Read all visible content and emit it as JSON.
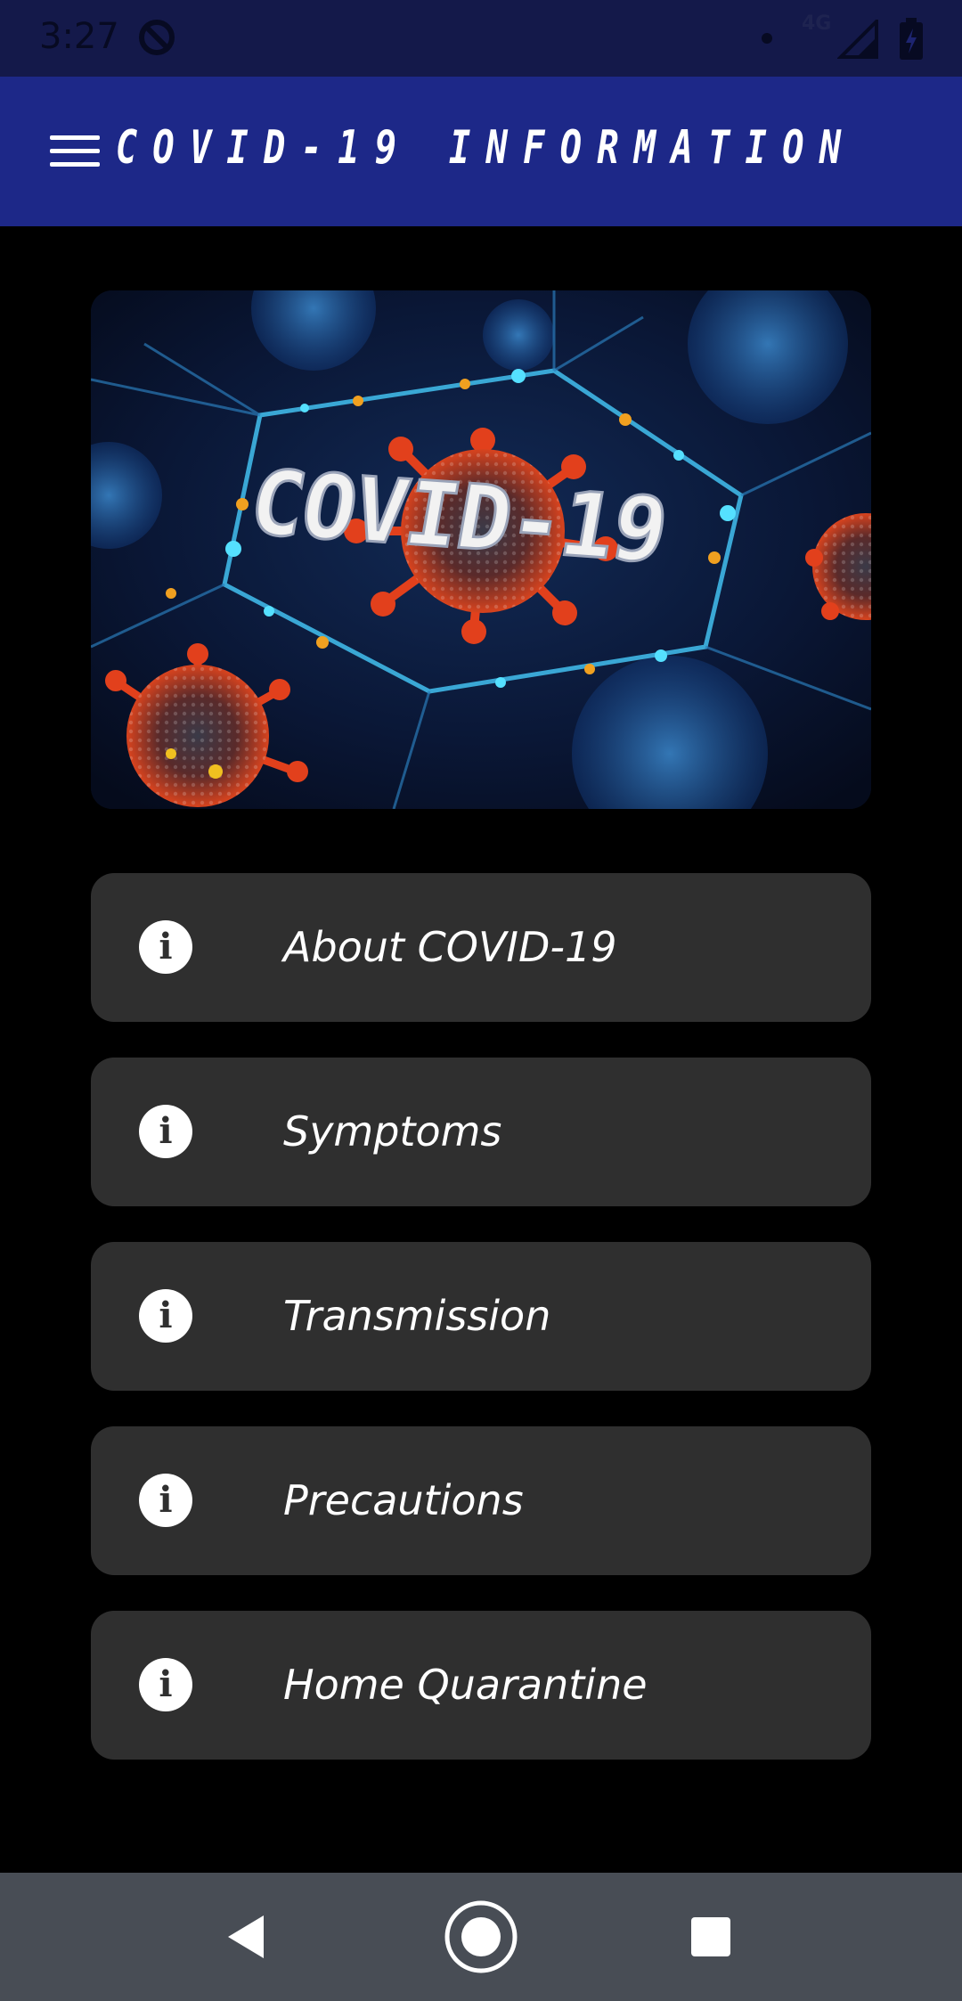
{
  "status_bar": {
    "time": "3:27",
    "network": "4G",
    "sync_icon": "sync-disabled-icon",
    "signal_icon": "signal-icon",
    "battery_icon": "battery-icon"
  },
  "app_bar": {
    "title": "COVID-19 INFORMATION",
    "menu_icon": "hamburger-menu-icon",
    "background": "#1d2888"
  },
  "hero": {
    "image_text": "COVID-19"
  },
  "info_items": [
    {
      "label": "About COVID-19",
      "icon": "info-icon"
    },
    {
      "label": "Symptoms",
      "icon": "info-icon"
    },
    {
      "label": "Transmission",
      "icon": "info-icon"
    },
    {
      "label": "Precautions",
      "icon": "info-icon"
    },
    {
      "label": "Home Quarantine",
      "icon": "info-icon"
    }
  ],
  "nav_bar": {
    "back_icon": "back-triangle-icon",
    "home_icon": "home-circle-icon",
    "recents_icon": "recents-square-icon"
  },
  "colors": {
    "status_bar": "#14194a",
    "app_bar": "#1d2888",
    "background": "#000000",
    "card": "#2f2f2f",
    "nav_bar": "#484d55"
  }
}
